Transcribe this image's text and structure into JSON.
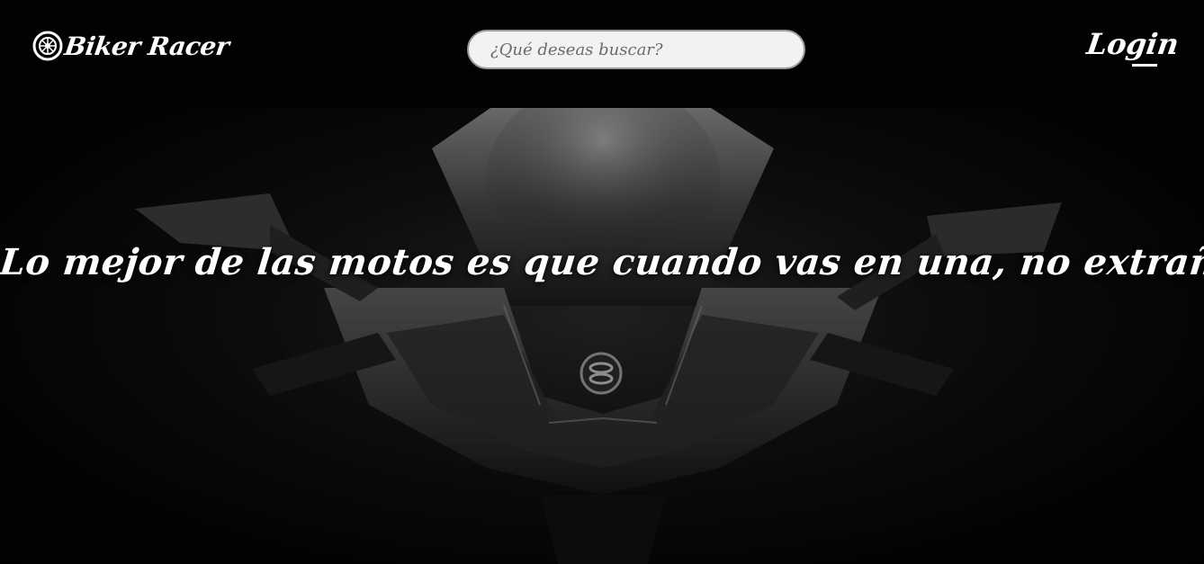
{
  "header": {
    "brand": {
      "name": "Biker Racer",
      "icon": "motorcycle-wheel-icon"
    },
    "search": {
      "placeholder": "¿Qué deseas buscar?",
      "value": ""
    },
    "login_label": "Login"
  },
  "hero": {
    "quote": "Lo mejor de las motos es que cuando vas en una, no extrañas a nadie.",
    "image": "motorcycle-front-photo"
  },
  "colors": {
    "header_bg": "#020202",
    "search_bg": "#f2f2f2",
    "search_border": "#9a9a9a",
    "text": "#ffffff"
  }
}
